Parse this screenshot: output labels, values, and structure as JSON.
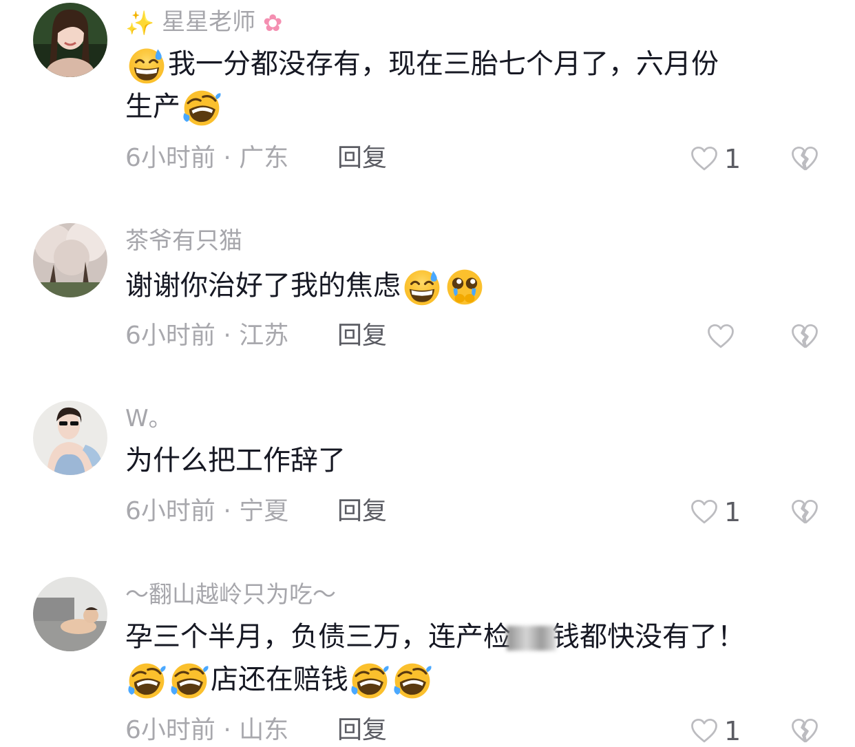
{
  "comments": [
    {
      "username_prefix_icon": "sparkles-icon",
      "username": "星星老师",
      "username_suffix_icon": "cherry-blossom-icon",
      "text_lines": [
        "我一分都没存有，现在三胎七个月了，六月份",
        "生产"
      ],
      "text_icons": [
        "grinning-sweat-emoji",
        "rolling-laughing-emoji"
      ],
      "meta": "6小时前 · 广东",
      "reply": "回复",
      "likes": "1"
    },
    {
      "username": "茶爷有只猫",
      "text": "谢谢你治好了我的焦虑",
      "text_icons": [
        "grinning-sweat-emoji",
        "pleading-tears-emoji"
      ],
      "meta": "6小时前 · 江苏",
      "reply": "回复",
      "likes": ""
    },
    {
      "username": "W。",
      "text": "为什么把工作辞了",
      "meta": "6小时前 · 宁夏",
      "reply": "回复",
      "likes": "1"
    },
    {
      "username": "～翻山越岭只为吃～",
      "text_line1_a": "孕三个半月，负债三万，连产检",
      "text_line1_b": "钱都快没有了！",
      "text_line2": "店还在赔钱",
      "text_icons": [
        "rolling-laughing-emoji"
      ],
      "meta": "6小时前 · 山东",
      "reply": "回复",
      "likes": "1"
    }
  ],
  "icons": {
    "like": "heart-outline-icon",
    "dislike": "broken-heart-icon"
  },
  "colors": {
    "text": "#161823",
    "meta": "#a8a8ad",
    "username": "#a6a6ab",
    "icon": "#bcbcc0"
  }
}
